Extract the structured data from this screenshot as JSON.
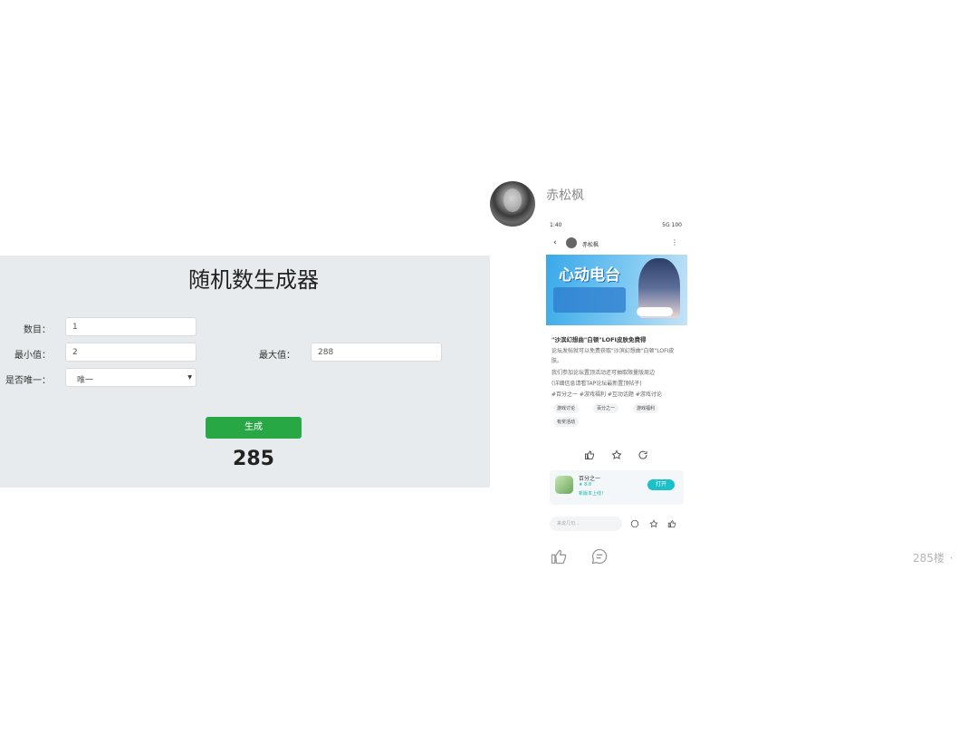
{
  "generator": {
    "title": "随机数生成器",
    "count_label": "数目：",
    "count_value": "1",
    "min_label": "最小值：",
    "min_value": "2",
    "max_label": "最大值：",
    "max_value": "288",
    "unique_label": "是否唯一：",
    "unique_selected": "唯一",
    "generate_label": "生成",
    "result": "285",
    "accent_color": "#28a745"
  },
  "post": {
    "author": "赤松枫",
    "floor": "285楼",
    "more_icon": "·",
    "screenshot": {
      "status_time": "1:40",
      "status_right": "5G 100",
      "author": "赤松枫",
      "post_title": "\"沙滨幻想曲\"白顿\"LOFI皮肤免费得",
      "line1": "论坛发帖就可以免费获取\"沙滨幻想曲\"白顿\"LOFI皮",
      "line1b": "肤。",
      "line2": "我们参加论坛置顶活动还可抽取限量版周边",
      "line3": "(详细信息请看TAP论坛最新置顶帖子)",
      "hashtags": "#百分之一 #游戏福利 #互动话题 #游戏讨论",
      "tags": [
        "游戏讨论",
        "百分之一",
        "游戏福利",
        "有奖活动"
      ],
      "game_name": "百分之一",
      "game_rating": "★ 8.8",
      "game_sub": "新版本上线！",
      "game_button": "打开",
      "comment_placeholder": "来说几句...",
      "banner_text": "心动电台"
    }
  }
}
